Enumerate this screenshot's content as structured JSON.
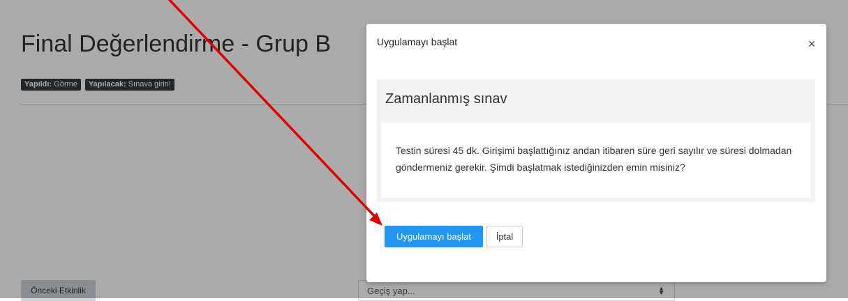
{
  "page": {
    "title": "Final Değerlendirme - Grup B",
    "badges": [
      {
        "label": "Yapıldı:",
        "value": "Görme"
      },
      {
        "label": "Yapılacak:",
        "value": "Sınava girin!"
      }
    ],
    "prev_activity_label": "Önceki Etkinlik",
    "jump_select_value": "Geçiş yap..."
  },
  "modal": {
    "title": "Uygulamayı başlat",
    "close_symbol": "×",
    "card_heading": "Zamanlanmış sınav",
    "card_text": "Testin süresi 45 dk. Girişimi başlattığınız andan itibaren süre geri sayılır ve süresi dolmadan göndermeniz gerekir. Şimdi başlatmak istediğinizden emin misiniz?",
    "start_button_label": "Uygulamayı başlat",
    "cancel_button_label": "İptal"
  },
  "colors": {
    "primary_button": "#2196f3",
    "annotation_arrow": "#e00000",
    "badge_background": "#343a40"
  }
}
